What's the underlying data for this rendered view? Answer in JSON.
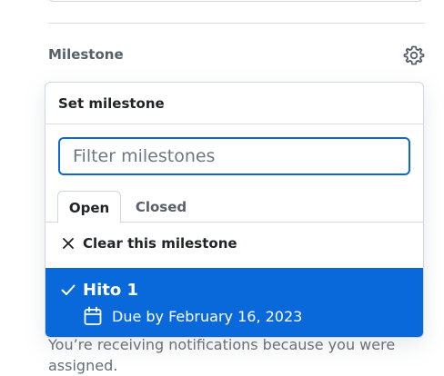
{
  "sidebar": {
    "milestone_label": "Milestone",
    "notification_text": "You’re receiving notifications because you were assigned."
  },
  "dropdown": {
    "title": "Set milestone",
    "filter_placeholder": "Filter milestones",
    "filter_value": "",
    "tabs": [
      {
        "label": "Open",
        "selected": true
      },
      {
        "label": "Closed",
        "selected": false
      }
    ],
    "clear_label": "Clear this milestone",
    "items": [
      {
        "title": "Hito 1",
        "due": "Due by February 16, 2023",
        "selected": true
      }
    ]
  },
  "icons": {
    "gear": "gear-icon",
    "clear": "x-icon",
    "check": "check-icon",
    "calendar": "calendar-icon"
  },
  "colors": {
    "accent": "#0969da",
    "border": "#d0d7de",
    "muted_text": "#57606a",
    "text": "#1f2328"
  }
}
